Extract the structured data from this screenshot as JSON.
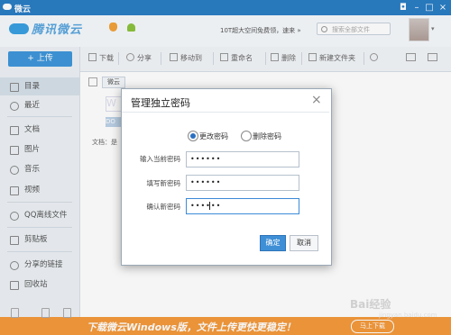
{
  "window": {
    "title": "微云"
  },
  "header": {
    "logo_text": "腾讯微云",
    "capacity_text": "10T超大空间免费领，速来 »",
    "search_placeholder": "搜索全部文件"
  },
  "sidebar": {
    "upload_label": "+ 上传",
    "items": [
      {
        "label": "目录",
        "icon": "folder-icon",
        "active": true
      },
      {
        "label": "最近",
        "icon": "clock-icon"
      },
      {
        "label": "文档",
        "icon": "document-icon"
      },
      {
        "label": "图片",
        "icon": "image-icon"
      },
      {
        "label": "音乐",
        "icon": "music-icon"
      },
      {
        "label": "视频",
        "icon": "video-icon"
      },
      {
        "label": "QQ离线文件",
        "icon": "qq-icon"
      },
      {
        "label": "剪贴板",
        "icon": "clipboard-icon"
      },
      {
        "label": "分享的链接",
        "icon": "link-icon"
      },
      {
        "label": "回收站",
        "icon": "trash-icon"
      }
    ]
  },
  "toolbar": {
    "download": "下载",
    "share": "分享",
    "move": "移动到",
    "rename": "重命名",
    "delete": "删除",
    "new_folder": "新建文件夹"
  },
  "content": {
    "breadcrumb": "微云",
    "file_info": "文档：是"
  },
  "dialog": {
    "title": "管理独立密码",
    "close": "×",
    "option_change": "更改密码",
    "option_delete": "删除密码",
    "label_current": "输入当前密码",
    "label_new": "填写新密码",
    "label_confirm": "确认新密码",
    "value_current": "••••••",
    "value_new": "••••••",
    "value_confirm": "••••••",
    "ok": "确定",
    "cancel": "取消"
  },
  "promo": {
    "text": "下载微云Windows版，文件上传更快更稳定！",
    "button": "马上下载"
  },
  "watermark": {
    "text": "Bai经验",
    "sub": "jingyan.baidu.com"
  },
  "colors": {
    "accent": "#3f8fd6",
    "titlebar": "#2a7dc4",
    "promo": "#f49a3c"
  }
}
